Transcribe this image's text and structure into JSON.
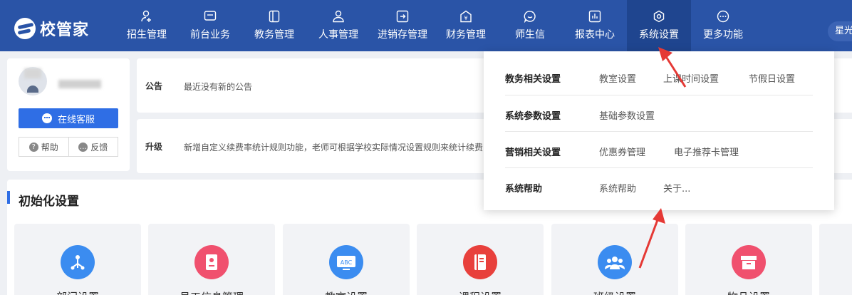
{
  "logo": {
    "text": "校管家"
  },
  "nav": {
    "items": [
      {
        "label": "招生管理",
        "icon": "person-plus-icon"
      },
      {
        "label": "前台业务",
        "icon": "monitor-icon"
      },
      {
        "label": "教务管理",
        "icon": "book-icon"
      },
      {
        "label": "人事管理",
        "icon": "person-icon"
      },
      {
        "label": "进销存管理",
        "icon": "arrow-box-icon"
      },
      {
        "label": "财务管理",
        "icon": "yen-icon"
      },
      {
        "label": "师生信",
        "icon": "chat-icon"
      },
      {
        "label": "报表中心",
        "icon": "chart-icon"
      },
      {
        "label": "系统设置",
        "icon": "gear-icon"
      },
      {
        "label": "更多功能",
        "icon": "more-icon"
      }
    ],
    "active": "系统设置",
    "user": "星光"
  },
  "profile": {
    "service_label": "在线客服",
    "help_label": "帮助",
    "feedback_label": "反馈"
  },
  "notices": [
    {
      "tag": "公告",
      "text": "最近没有新的公告"
    },
    {
      "tag": "升级",
      "text": "新增自定义续费率统计规则功能，老师可根据学校实际情况设置规则来统计续费"
    }
  ],
  "init": {
    "title": "初始化设置",
    "cards": [
      {
        "label": "部门设置",
        "color": "#3b8cf0"
      },
      {
        "label": "员工信息管理",
        "color": "#f0506e"
      },
      {
        "label": "教室设置",
        "color": "#3b8cf0",
        "badge": "ABC"
      },
      {
        "label": "课程设置",
        "color": "#e8403c"
      },
      {
        "label": "班级设置",
        "color": "#3b8cf0"
      },
      {
        "label": "物品设置",
        "color": "#f0506e"
      }
    ]
  },
  "dropdown": {
    "rows": [
      {
        "head": "教务相关设置",
        "links": [
          "教室设置",
          "上课时间设置",
          "节假日设置"
        ]
      },
      {
        "head": "系统参数设置",
        "links": [
          "基础参数设置"
        ]
      },
      {
        "head": "营销相关设置",
        "links": [
          "优惠券管理",
          "电子推荐卡管理"
        ]
      },
      {
        "head": "系统帮助",
        "links": [
          "系统帮助",
          "关于..."
        ]
      }
    ]
  },
  "colors": {
    "topbar": "#2a54a7",
    "active_nav": "#1f458f",
    "primary": "#2f6ee5",
    "annotation_arrow": "#e53935"
  }
}
